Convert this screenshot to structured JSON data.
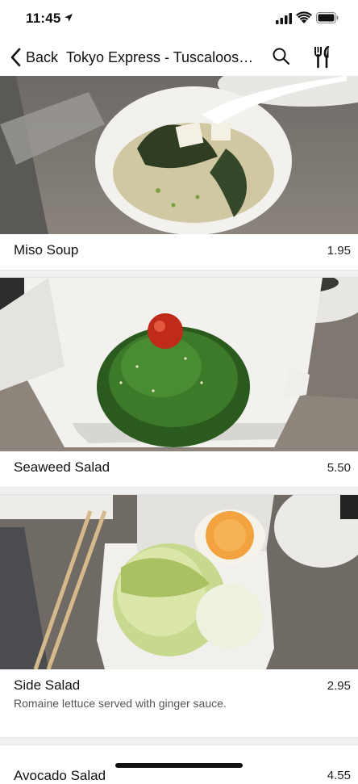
{
  "status_bar": {
    "time": "11:45"
  },
  "nav": {
    "back_label": "Back",
    "title": "Tokyo Express - Tuscaloosa..."
  },
  "menu_items": [
    {
      "name": "Miso Soup",
      "price": "1.95",
      "description": ""
    },
    {
      "name": "Seaweed Salad",
      "price": "5.50",
      "description": ""
    },
    {
      "name": "Side Salad",
      "price": "2.95",
      "description": "Romaine lettuce served with ginger sauce."
    },
    {
      "name": "Avocado Salad",
      "price": "4.55",
      "description": ""
    }
  ],
  "icons": {
    "back": "chevron-left-icon",
    "search": "search-icon",
    "menu": "fork-knife-icon",
    "location": "location-arrow-icon",
    "signal": "cellular-signal-icon",
    "wifi": "wifi-icon",
    "battery": "battery-icon"
  },
  "colors": {
    "text": "#111111",
    "divider": "#f0f0f0"
  }
}
